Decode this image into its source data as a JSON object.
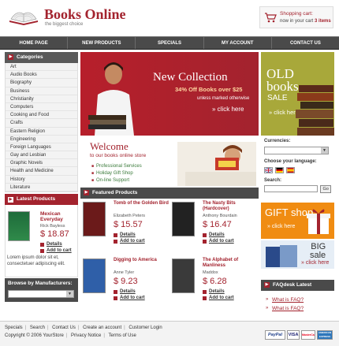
{
  "header": {
    "logo_title": "Books Online",
    "tagline": "the biggest choice",
    "cart_label": "Shopping cart:",
    "cart_now": "now in your cart",
    "cart_count": "3 items"
  },
  "nav": [
    "HOME PAGE",
    "NEW PRODUCTS",
    "SPECIALS",
    "MY ACCOUNT",
    "CONTACT US"
  ],
  "categories": {
    "title": "Categories",
    "items": [
      "Art",
      "Audio Books",
      "Biography",
      "Business",
      "Christianity",
      "Computers",
      "Cooking and Food",
      "Crafts",
      "Eastern Religion",
      "Engineering",
      "Foreign Languages",
      "Gay and Lesbian",
      "Graphic Novels",
      "Health and Medicine",
      "History",
      "Literature"
    ]
  },
  "latest": {
    "title": "Latest Products",
    "product_title": "Mexican Everyday",
    "author": "Rick Bayless",
    "price": "$ 18.87",
    "details": "Details",
    "add": "Add to cart",
    "lorem": "Lorem ipsum dolor sit et, consectetuer adipiscing elit."
  },
  "manufacturers": {
    "title": "Browse by Manufacturers:"
  },
  "banner": {
    "title": "New Collection",
    "offer": "34% Off Books over $25",
    "unless": "unless marked otherwise",
    "click": "» click here"
  },
  "welcome": {
    "title": "Welcome",
    "subtitle": "to our books online store",
    "items": [
      "Professional Services",
      "Holiday Gift Shop",
      "On-line Support"
    ]
  },
  "featured": {
    "title": "Featured Products",
    "products": [
      {
        "title": "Tomb of the Golden Bird",
        "author": "Elizabeth Peters",
        "price": "$ 15.57",
        "details": "Details",
        "add": "Add to cart",
        "cover": "#6b1a1a"
      },
      {
        "title": "The Nasty Bits (Hardcover)",
        "author": "Anthony Bourdain",
        "price": "$ 16.47",
        "details": "Details",
        "add": "Add to cart",
        "cover": "#222222"
      },
      {
        "title": "Digging to America",
        "author": "Anne Tyler",
        "price": "$ 9.23",
        "details": "Details",
        "add": "Add to cart",
        "cover": "#2f5fa8"
      },
      {
        "title": "The Alphabet of Manliness",
        "author": "Maddox",
        "price": "$ 6.28",
        "details": "Details",
        "add": "Add to cart",
        "cover": "#3a3a3a"
      }
    ]
  },
  "oldbooks": {
    "title1": "OLD",
    "title2": "books",
    "sale": "SALE",
    "click": "» click here"
  },
  "currencies": {
    "label": "Currencies:"
  },
  "language": {
    "label": "Choose your language:"
  },
  "search": {
    "label": "Search:",
    "go": "Go"
  },
  "gift": {
    "title": "GIFT shop",
    "click": "» click here"
  },
  "bigsale": {
    "big": "BIG",
    "sale": "sale",
    "click": "» click here"
  },
  "faq": {
    "title": "FAQdesk Latest",
    "items": [
      "What is FAQ?",
      "What is FAQ?"
    ]
  },
  "footer": {
    "links": [
      "Specials",
      "Search",
      "Contact Us",
      "Create an account",
      "Customer Login"
    ],
    "copyright": "Copyright © 2006 YourStore",
    "copy_links": [
      "Privacy Notice",
      "Terms of Use"
    ],
    "payments": [
      "PayPal",
      "VISA",
      "MasterCard",
      "AMERICAN EXPRESS"
    ]
  },
  "colors": {
    "accent": "#a3232e",
    "nav": "#4a4a4a",
    "olive": "#a8a83a",
    "orange": "#f08c12"
  }
}
